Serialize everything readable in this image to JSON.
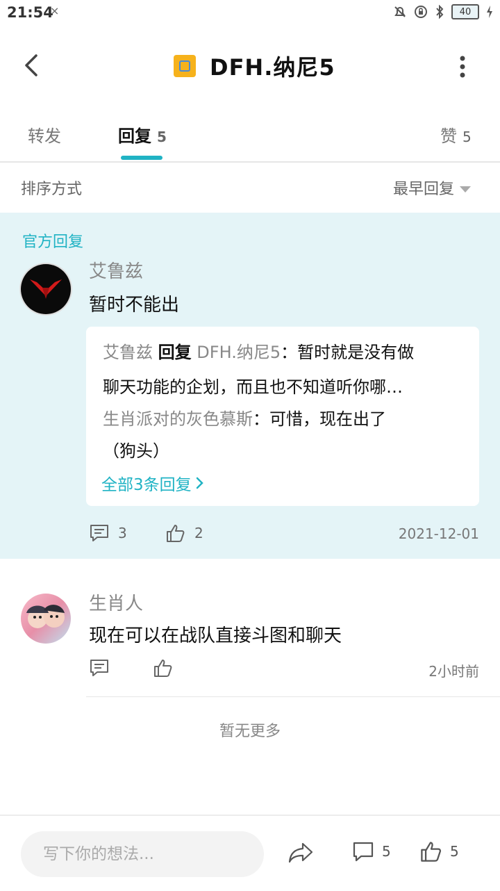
{
  "status_bar": {
    "time": "21:54",
    "signal": "×",
    "battery": "40"
  },
  "header": {
    "title": "DFH.纳尼5"
  },
  "tabs": [
    {
      "label": "转发",
      "count": ""
    },
    {
      "label": "回复",
      "count": "5"
    },
    {
      "label": "赞",
      "count": "5"
    }
  ],
  "sort": {
    "label": "排序方式",
    "selected": "最早回复"
  },
  "official_reply": {
    "tag": "官方回复",
    "author": "艾鲁兹",
    "text": "暂时不能出",
    "quote": {
      "line1_name": "艾鲁兹",
      "line1_verb": "回复",
      "line1_target": "DFH.纳尼5",
      "line1_text": "：暂时就是没有做",
      "line2": "聊天功能的企划，而且也不知道听你哪…",
      "line3_name": "生肖派对的灰色慕斯",
      "line3_text": "：可惜，现在出了",
      "line4": "（狗头）",
      "all_replies": "全部3条回复"
    },
    "comment_count": "3",
    "like_count": "2",
    "date": "2021-12-01"
  },
  "reply2": {
    "author": "生肖人",
    "text": "现在可以在战队直接斗图和聊天",
    "time": "2小时前"
  },
  "no_more": "暂无更多",
  "bottom_bar": {
    "placeholder": "写下你的想法...",
    "comment_count": "5",
    "like_count": "5"
  },
  "colors": {
    "accent": "#20b3c4",
    "official_bg": "#e4f4f7"
  }
}
